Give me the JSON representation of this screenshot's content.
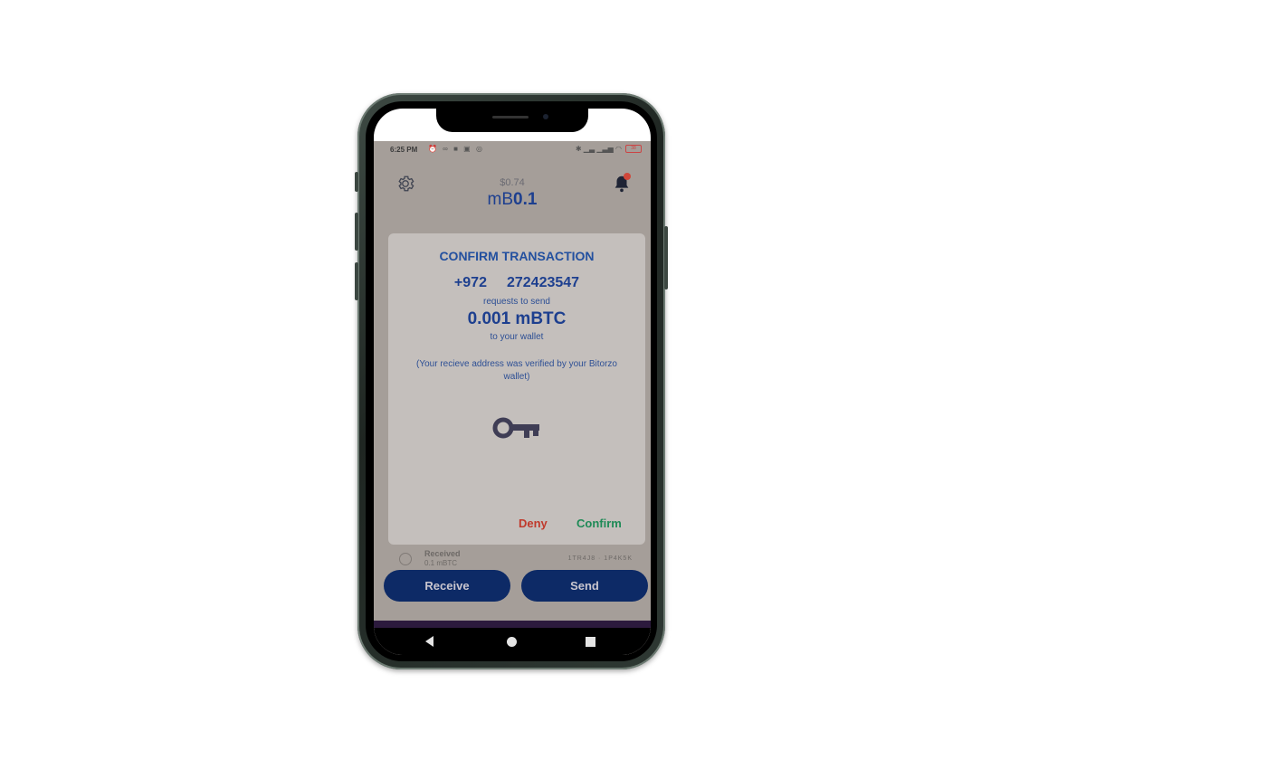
{
  "status_bar": {
    "time": "6:25 PM",
    "left_icons": "⏰ ∞ ■ ▣ ◎",
    "right_icons": "✱ ▁▃ ▁▃▅ ◠",
    "battery": "38"
  },
  "header": {
    "balance_usd": "$0.74",
    "balance_symbol": "mB",
    "balance_amount": "0.1",
    "settings_icon": "gear-icon",
    "notifications_icon": "bell-icon"
  },
  "transaction": {
    "label": "Received",
    "amount": "0.1 mBTC",
    "meta": "1TR4J8 · 1P4K5K"
  },
  "buttons": {
    "receive": "Receive",
    "send": "Send"
  },
  "dialog": {
    "title": "CONFIRM TRANSACTION",
    "country_code": "+972",
    "phone_number": "272423547",
    "requests_text": "requests to send",
    "amount": "0.001 mBTC",
    "to_wallet_text": "to your wallet",
    "note": "(Your recieve address was verified by your Bitorzo wallet)",
    "icon": "key-icon",
    "deny_label": "Deny",
    "confirm_label": "Confirm"
  },
  "colors": {
    "primary_blue": "#1d3f8f",
    "button_navy": "#0d2a66",
    "deny_red": "#c0392b",
    "confirm_green": "#1e8a56"
  }
}
